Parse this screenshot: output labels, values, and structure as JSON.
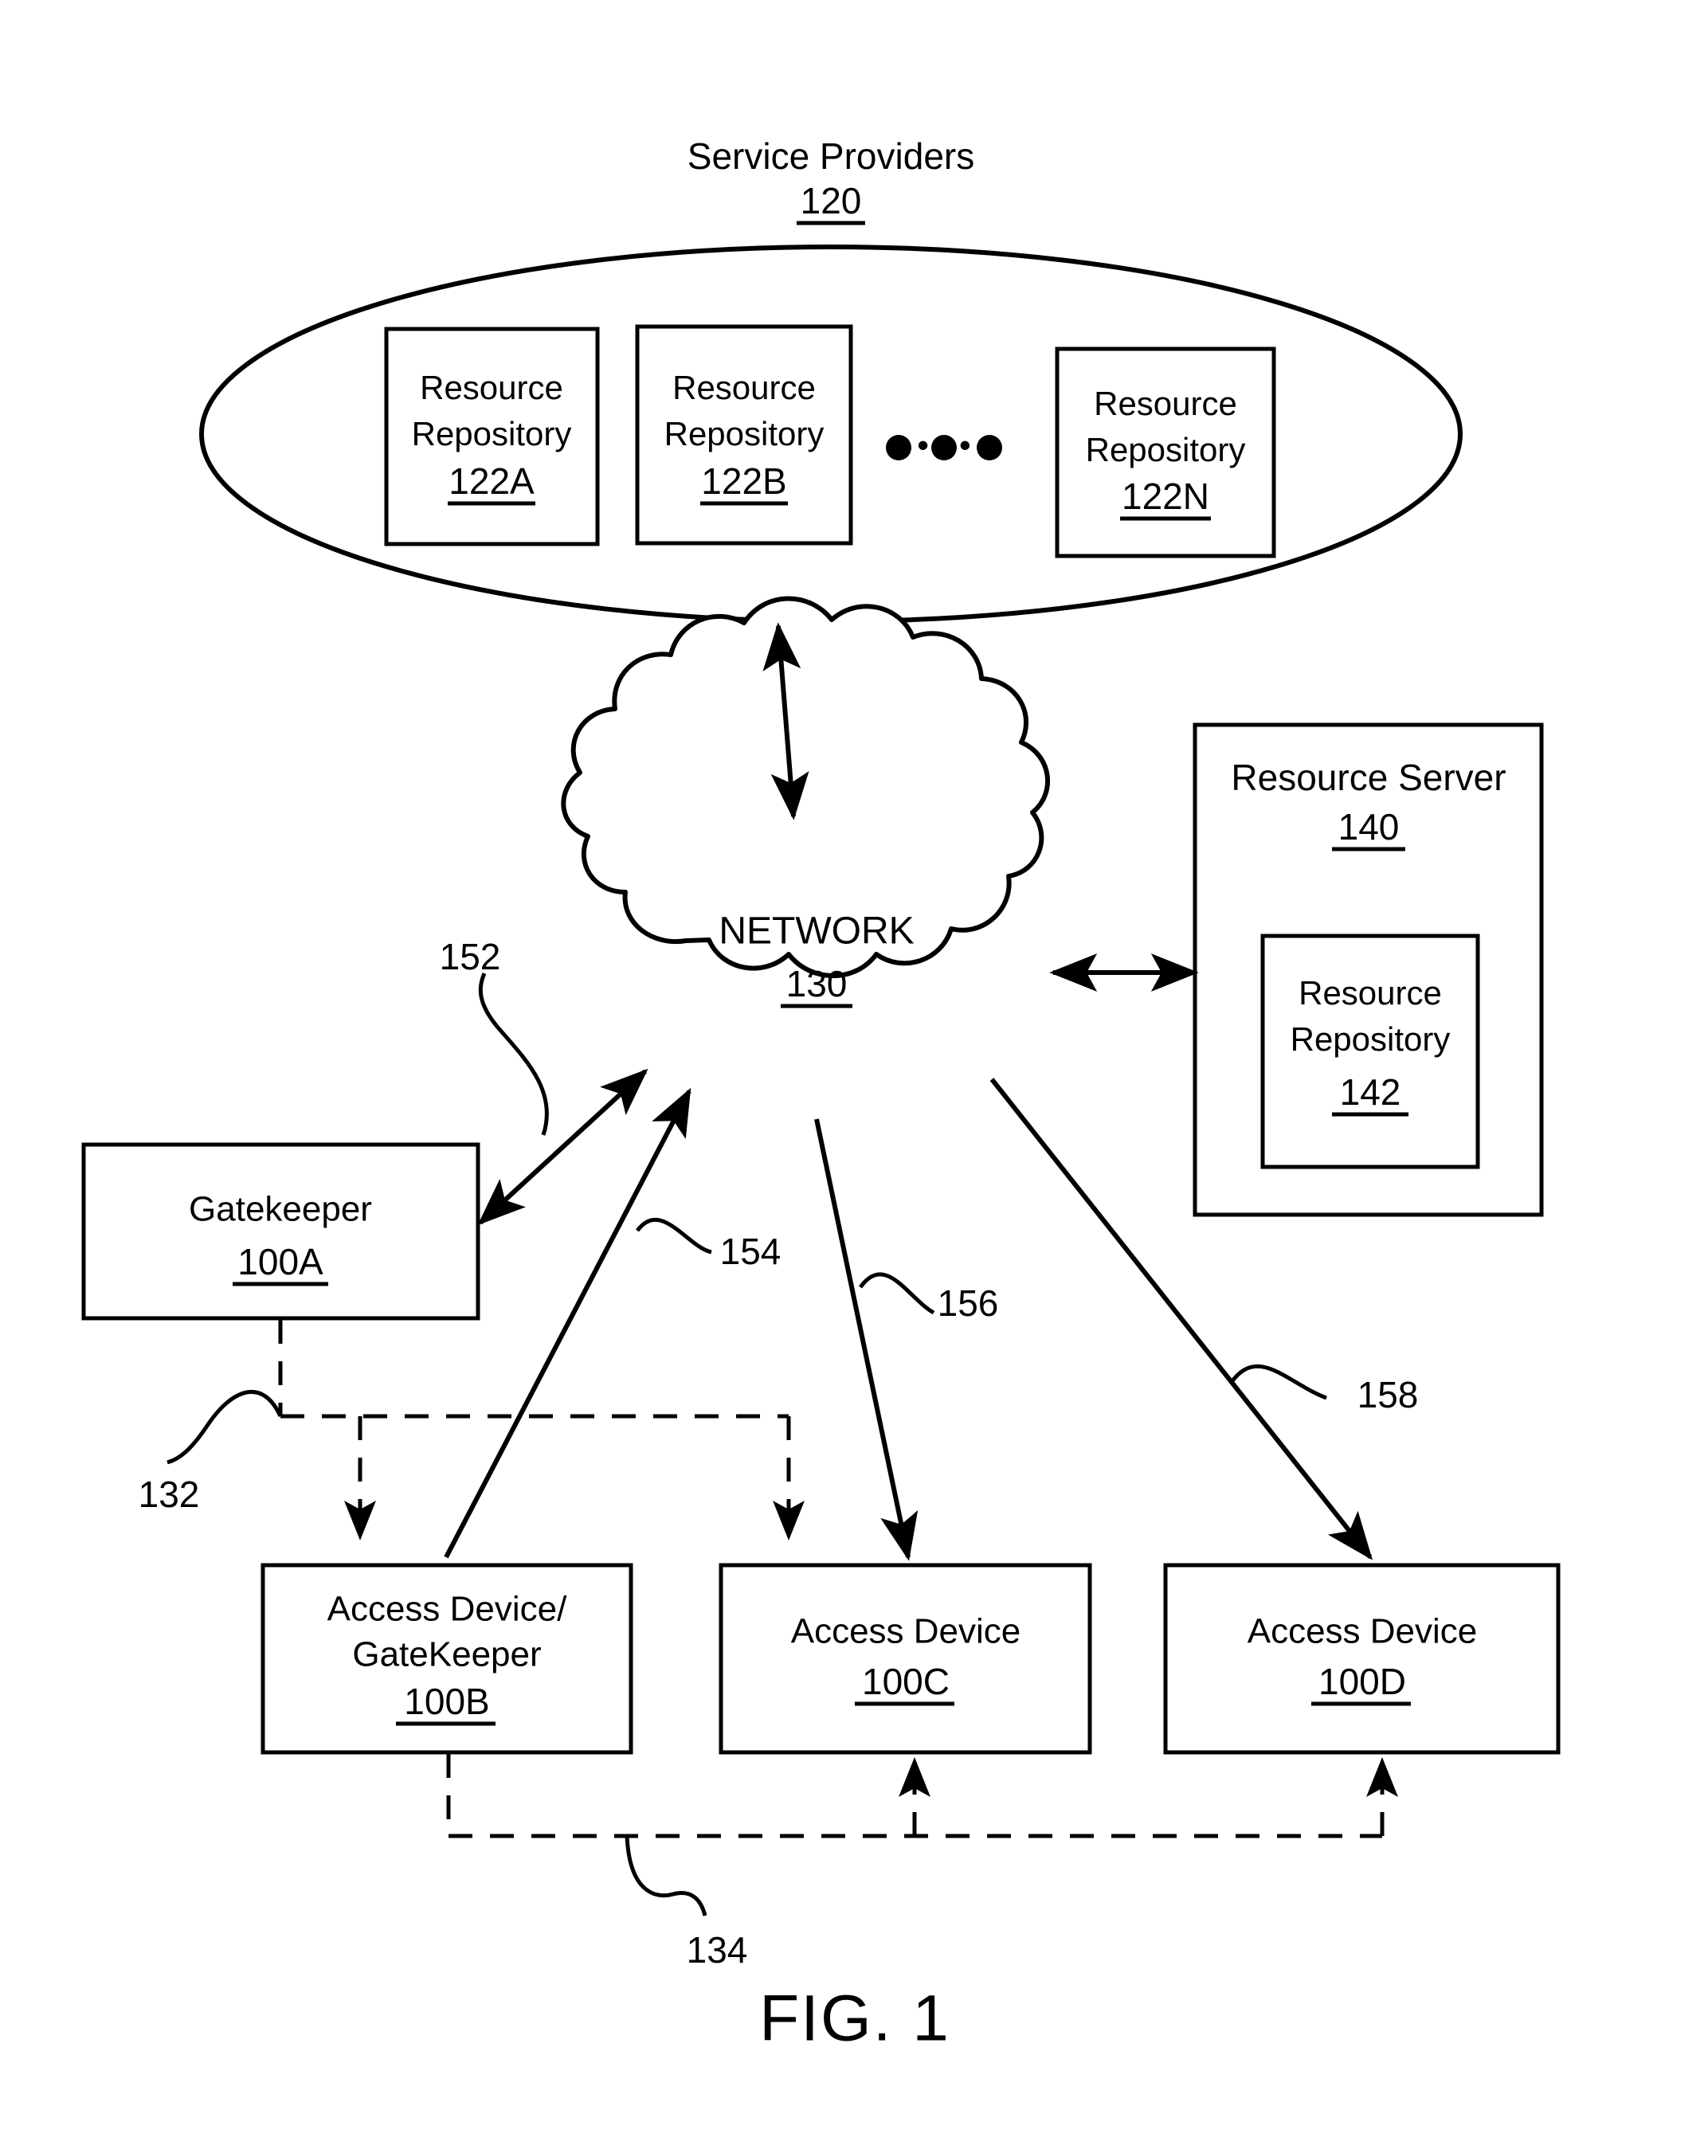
{
  "figure": {
    "caption": "FIG. 1"
  },
  "service_providers": {
    "title": "Service Providers",
    "ref": "120",
    "ellipsis": "• • •",
    "repositories": [
      {
        "line1": "Resource",
        "line2": "Repository",
        "ref": "122A"
      },
      {
        "line1": "Resource",
        "line2": "Repository",
        "ref": "122B"
      },
      {
        "line1": "Resource",
        "line2": "Repository",
        "ref": "122N"
      }
    ]
  },
  "network": {
    "label": "NETWORK",
    "ref": "130"
  },
  "resource_server": {
    "title": "Resource Server",
    "ref": "140",
    "inner": {
      "line1": "Resource",
      "line2": "Repository",
      "ref": "142"
    }
  },
  "gatekeeper": {
    "title": "Gatekeeper",
    "ref": "100A"
  },
  "access_devices": [
    {
      "line1": "Access Device/",
      "line2": "GateKeeper",
      "ref": "100B"
    },
    {
      "line1": "Access Device",
      "line2": "",
      "ref": "100C"
    },
    {
      "line1": "Access Device",
      "line2": "",
      "ref": "100D"
    }
  ],
  "reference_numerals": {
    "link_152": "152",
    "link_154": "154",
    "link_156": "156",
    "link_158": "158",
    "link_132": "132",
    "link_134": "134"
  },
  "colors": {
    "ink": "#000000",
    "paper": "#ffffff"
  }
}
